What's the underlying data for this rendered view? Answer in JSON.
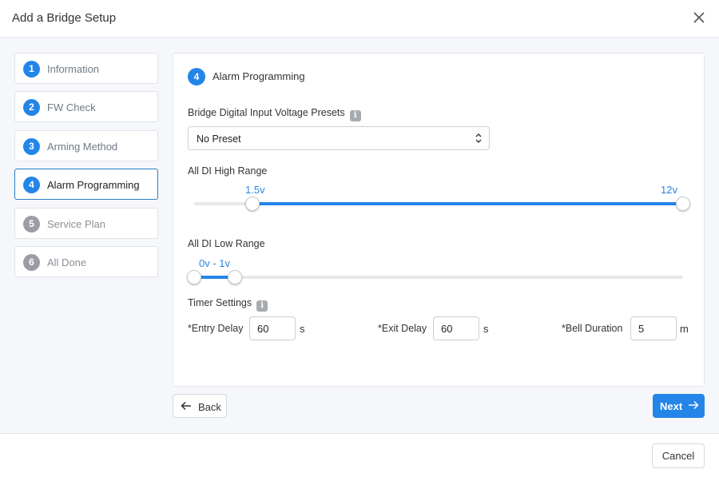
{
  "dialog": {
    "title": "Add a Bridge Setup"
  },
  "steps": [
    {
      "number": "1",
      "label": "Information",
      "state": "done"
    },
    {
      "number": "2",
      "label": "FW Check",
      "state": "done"
    },
    {
      "number": "3",
      "label": "Arming Method",
      "state": "done"
    },
    {
      "number": "4",
      "label": "Alarm Programming",
      "state": "active"
    },
    {
      "number": "5",
      "label": "Service Plan",
      "state": "pending"
    },
    {
      "number": "6",
      "label": "All Done",
      "state": "pending"
    }
  ],
  "panel": {
    "number": "4",
    "title": "Alarm Programming",
    "presets": {
      "label": "Bridge Digital Input Voltage Presets",
      "info_icon": "i",
      "selected": "No Preset"
    },
    "high_range": {
      "label": "All DI High Range",
      "min_label": "1.5v",
      "max_label": "12v",
      "low_value_fraction": 0.12,
      "high_value_fraction": 1.0
    },
    "low_range": {
      "label": "All DI Low Range",
      "value_label": "0v - 1v",
      "low_value_fraction": 0.0,
      "high_value_fraction": 0.083
    },
    "timer": {
      "label": "Timer Settings",
      "info_icon": "i",
      "entry_delay": {
        "label": "*Entry Delay",
        "value": "60",
        "unit": "s"
      },
      "exit_delay": {
        "label": "*Exit Delay",
        "value": "60",
        "unit": "s"
      },
      "bell_duration": {
        "label": "*Bell Duration",
        "value": "5",
        "unit": "m"
      }
    }
  },
  "buttons": {
    "back": "Back",
    "next": "Next",
    "cancel": "Cancel"
  },
  "colors": {
    "accent": "#2485e8",
    "pending": "#9a9ea3",
    "background": "#f5f7fa"
  }
}
